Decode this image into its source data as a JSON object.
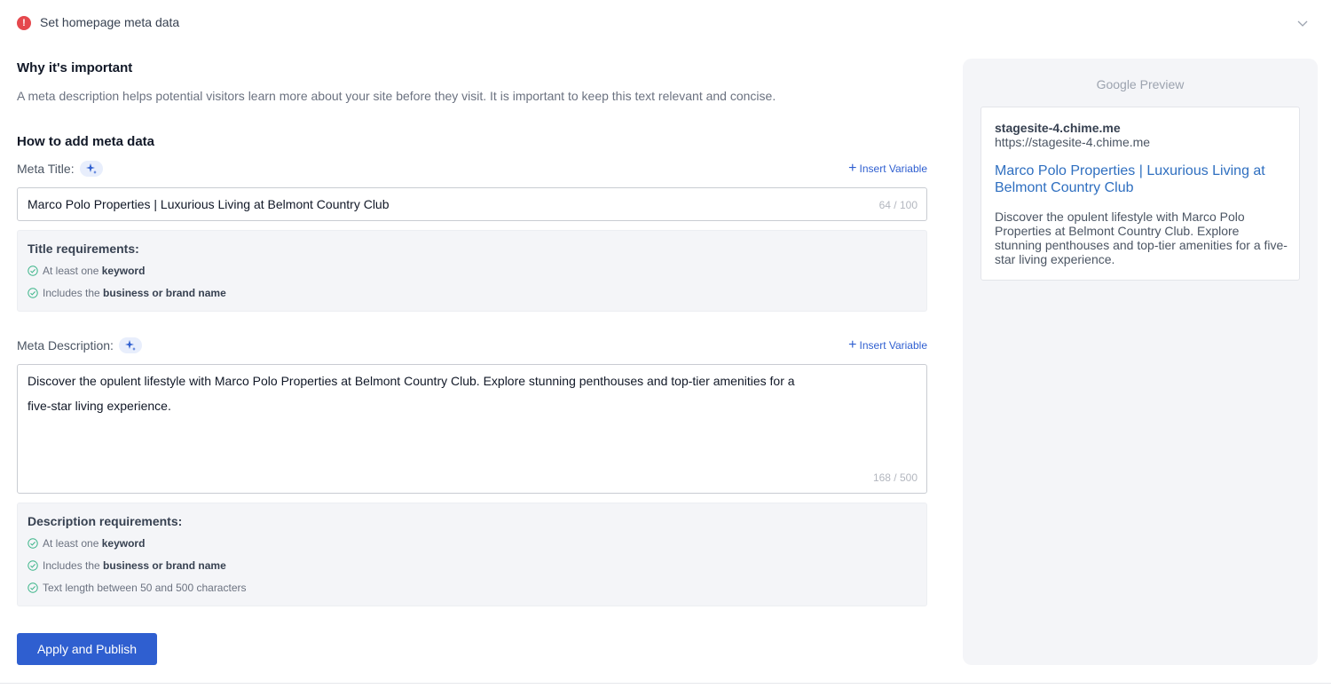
{
  "header": {
    "title": "Set homepage meta data",
    "alert_glyph": "!"
  },
  "section_why": {
    "heading": "Why it's important",
    "text": "A meta description helps potential visitors learn more about your site before they visit. It is important to keep this text relevant and concise."
  },
  "section_how": {
    "heading": "How to add meta data"
  },
  "meta_title": {
    "label": "Meta Title:",
    "insert_variable": "Insert Variable",
    "value": "Marco Polo Properties | Luxurious Living at Belmont Country Club",
    "counter": "64 / 100",
    "requirements_title": "Title requirements:",
    "requirements": [
      {
        "prefix": "At least one ",
        "bold": "keyword"
      },
      {
        "prefix": "Includes the ",
        "bold": "business or brand name"
      }
    ]
  },
  "meta_description": {
    "label": "Meta Description:",
    "insert_variable": "Insert Variable",
    "value_line1": "Discover the opulent lifestyle with Marco Polo Properties at Belmont Country Club. Explore stunning penthouses and top-tier amenities for a",
    "value_line2": "five-star living experience.",
    "counter": "168 / 500",
    "requirements_title": "Description requirements:",
    "requirements": [
      {
        "prefix": "At least one ",
        "bold": "keyword"
      },
      {
        "prefix": "Includes the ",
        "bold": "business or brand name"
      },
      {
        "prefix": "Text length between 50 and 500 characters",
        "bold": ""
      }
    ]
  },
  "publish_button": "Apply and Publish",
  "google_preview": {
    "heading": "Google Preview",
    "domain": "stagesite-4.chime.me",
    "url": "https://stagesite-4.chime.me",
    "title": "Marco Polo Properties | Luxurious Living at Belmont Country Club",
    "description": "Discover the opulent lifestyle with Marco Polo Properties at Belmont Country Club. Explore stunning penthouses and top-tier amenities for a five-star living experience."
  },
  "colors": {
    "accent": "#2f5fd0",
    "alert": "#e5484d",
    "success": "#3fb68b",
    "link": "#2f6fc0"
  },
  "icons": [
    "alert-icon",
    "chevron-down-icon",
    "sparkle-icon",
    "plus-icon",
    "check-circle-icon"
  ]
}
